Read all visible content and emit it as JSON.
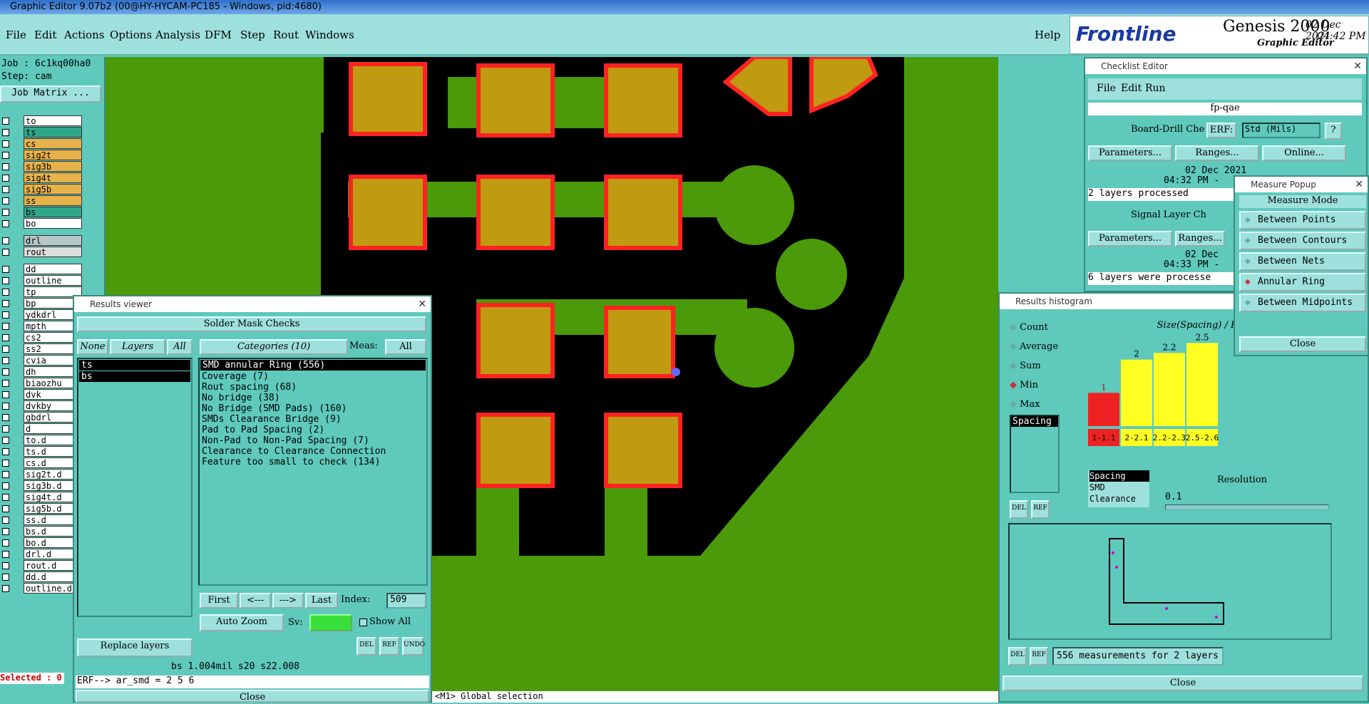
{
  "window_title": "Graphic Editor 9.07b2 (00@HY-HYCAM-PC185 - Windows, pid:4680)",
  "menu": {
    "file": "File",
    "edit": "Edit",
    "actions": "Actions",
    "options": "Options",
    "analysis": "Analysis",
    "dfm": "DFM",
    "step": "Step",
    "rout": "Rout",
    "windows": "Windows",
    "help": "Help"
  },
  "logo": {
    "brand": "Frontline",
    "product": "Genesis 2000",
    "subtitle": "Graphic Editor",
    "date": "02 Dec 2021",
    "time": "04:42 PM"
  },
  "left": {
    "job": "Job : 6c1kq00ha0",
    "step": "Step: cam",
    "job_matrix": "Job Matrix ...",
    "selected": "Selected : 0"
  },
  "layers": [
    {
      "name": "to",
      "color": "#ffffff"
    },
    {
      "name": "ts",
      "color": "#2fa88a"
    },
    {
      "name": "cs",
      "color": "#e8b24a"
    },
    {
      "name": "sig2t",
      "color": "#e8b24a"
    },
    {
      "name": "sig3b",
      "color": "#e8b24a"
    },
    {
      "name": "sig4t",
      "color": "#e8b24a"
    },
    {
      "name": "sig5b",
      "color": "#e8b24a"
    },
    {
      "name": "ss",
      "color": "#e8b24a"
    },
    {
      "name": "bs",
      "color": "#2fa88a"
    },
    {
      "name": "bo",
      "color": "#ffffff"
    },
    {
      "name": "drl",
      "color": "#b7c7c7"
    },
    {
      "name": "rout",
      "color": "#dddddd"
    },
    {
      "name": "dd",
      "color": "#ffffff"
    },
    {
      "name": "outline",
      "color": "#ffffff"
    },
    {
      "name": "tp",
      "color": "#ffffff"
    },
    {
      "name": "bp",
      "color": "#ffffff"
    },
    {
      "name": "ydkdrl",
      "color": "#ffffff"
    },
    {
      "name": "mpth",
      "color": "#ffffff"
    },
    {
      "name": "cs2",
      "color": "#ffffff"
    },
    {
      "name": "ss2",
      "color": "#ffffff"
    },
    {
      "name": "cvia",
      "color": "#ffffff"
    },
    {
      "name": "dh",
      "color": "#ffffff"
    },
    {
      "name": "biaozhu",
      "color": "#ffffff"
    },
    {
      "name": "dvk",
      "color": "#ffffff"
    },
    {
      "name": "dvkby",
      "color": "#ffffff"
    },
    {
      "name": "gbdrl",
      "color": "#ffffff"
    },
    {
      "name": "d",
      "color": "#ffffff"
    },
    {
      "name": "to.d",
      "color": "#ffffff"
    },
    {
      "name": "ts.d",
      "color": "#ffffff"
    },
    {
      "name": "cs.d",
      "color": "#ffffff"
    },
    {
      "name": "sig2t.d",
      "color": "#ffffff"
    },
    {
      "name": "sig3b.d",
      "color": "#ffffff"
    },
    {
      "name": "sig4t.d",
      "color": "#ffffff"
    },
    {
      "name": "sig5b.d",
      "color": "#ffffff"
    },
    {
      "name": "ss.d",
      "color": "#ffffff"
    },
    {
      "name": "bs.d",
      "color": "#ffffff"
    },
    {
      "name": "bo.d",
      "color": "#ffffff"
    },
    {
      "name": "drl.d",
      "color": "#ffffff"
    },
    {
      "name": "rout.d",
      "color": "#ffffff"
    },
    {
      "name": "dd.d",
      "color": "#ffffff"
    },
    {
      "name": "outline.d",
      "color": "#ffffff"
    }
  ],
  "results": {
    "title": "Results viewer",
    "header": "Solder Mask Checks",
    "none": "None",
    "layers": "Layers",
    "all": "All",
    "categories": "Categories (10)",
    "meas": "Meas:",
    "meas_value": "All",
    "layer_items": [
      "ts",
      "bs"
    ],
    "cat_items": [
      "SMD annular Ring (556)",
      "Coverage (7)",
      "Rout spacing (68)",
      "No bridge (38)",
      "No Bridge (SMD Pads) (160)",
      "SMDs Clearance Bridge (9)",
      "Pad to Pad Spacing (2)",
      "Non-Pad to Non-Pad Spacing (7)",
      "Clearance to Clearance Connection",
      "Feature too small to check (134)"
    ],
    "first": "First",
    "prev": "<---",
    "next": "--->",
    "last": "Last",
    "index_label": "Index:",
    "index_value": "509",
    "auto_zoom": "Auto Zoom",
    "sv": "Sv:",
    "show_all": "Show All",
    "replace": "Replace layers",
    "del": "DEL",
    "ref": "REF",
    "undo": "UNDO",
    "status": "bs 1.004mil  s20  s22.008",
    "erf": "ERF--> ar_smd = 2 5 6",
    "close": "Close"
  },
  "checklist": {
    "title": "Checklist Editor",
    "file": "File",
    "edit": "Edit",
    "run": "Run",
    "name": "fp-qae",
    "item1": "Board-Drill Che",
    "erf": "ERF:",
    "std": "Std (Mils)",
    "q": "?",
    "params": "Parameters...",
    "ranges": "Ranges...",
    "online": "Online...",
    "date1": "02 Dec 2021",
    "time1": "04:32 PM -",
    "msg1": "2 layers processed",
    "item2": "Signal Layer Ch",
    "date2": "02 Dec",
    "time2": "04:33 PM -",
    "msg2": "6 layers were processe"
  },
  "measure": {
    "title": "Measure Popup",
    "mode": "Measure Mode",
    "opts": [
      "Between Points",
      "Between Contours",
      "Between Nets",
      "Annular Ring",
      "Between Midpoints"
    ],
    "selected": 3,
    "close": "Close"
  },
  "histogram": {
    "title": "Results histogram",
    "opts": [
      "Count",
      "Average",
      "Sum",
      "Min",
      "Max"
    ],
    "selected": 3,
    "list": [
      "Spacing"
    ],
    "chart_title": "Size(Spacing) / Hi",
    "resolution": "Resolution",
    "res_value": "0.1",
    "types": [
      "Spacing",
      "SMD",
      "Clearance"
    ],
    "summary": "556 measurements for 2 layers",
    "close": "Close",
    "del": "DEL",
    "ref": "REF"
  },
  "chart_data": {
    "type": "bar",
    "categories": [
      "1-1.1",
      "2-2.1",
      "2.2-2.3",
      "2.5-2.6"
    ],
    "values": [
      1,
      2,
      2.2,
      2.5
    ],
    "colors": [
      "#ee2222",
      "#ffff22",
      "#ffff22",
      "#ffff22"
    ],
    "title": "Size(Spacing) / Hi"
  },
  "bottom_prompt": "<M1> Global selection"
}
